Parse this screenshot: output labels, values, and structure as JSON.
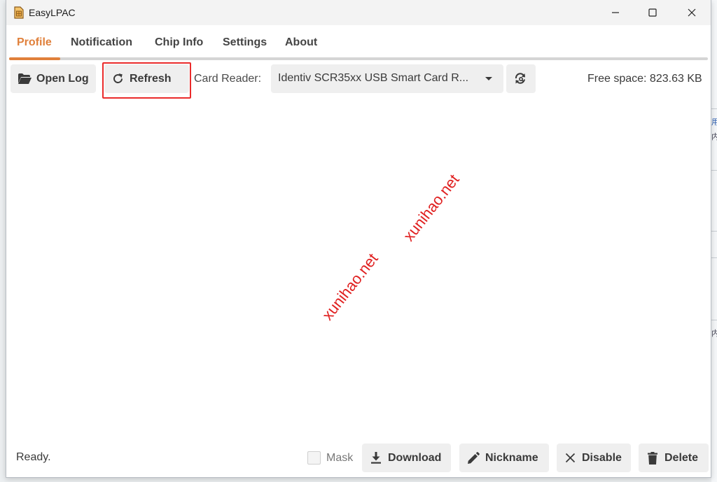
{
  "window": {
    "title": "EasyLPAC"
  },
  "tabs": [
    {
      "label": "Profile",
      "active": true
    },
    {
      "label": "Notification",
      "active": false
    },
    {
      "label": "Chip Info",
      "active": false
    },
    {
      "label": "Settings",
      "active": false
    },
    {
      "label": "About",
      "active": false
    }
  ],
  "toolbar": {
    "open_log_label": "Open Log",
    "refresh_label": "Refresh",
    "card_reader_label": "Card Reader:",
    "card_reader_value": "Identiv SCR35xx USB Smart Card R...",
    "free_space": "Free space: 823.63 KB"
  },
  "watermark": {
    "text_1": "xunihao.net",
    "text_2": "xunihao.net"
  },
  "bottom": {
    "status": "Ready.",
    "mask_label": "Mask",
    "mask_checked": false,
    "download_label": "Download",
    "nickname_label": "Nickname",
    "disable_label": "Disable",
    "delete_label": "Delete"
  },
  "background_window": {
    "glyphs": [
      "用",
      "内",
      "内"
    ]
  },
  "colors": {
    "accent": "#e0803b",
    "highlight": "#ea2b2b",
    "button_bg": "#efefef",
    "watermark": "#e02020"
  },
  "icons": {
    "app": "sim-card-icon",
    "open_log": "folder-open-icon",
    "refresh": "refresh-icon",
    "dropdown": "caret-down-icon",
    "rescan": "rescan-icon",
    "download": "download-icon",
    "nickname": "pencil-icon",
    "disable": "close-icon",
    "delete": "trash-icon"
  }
}
